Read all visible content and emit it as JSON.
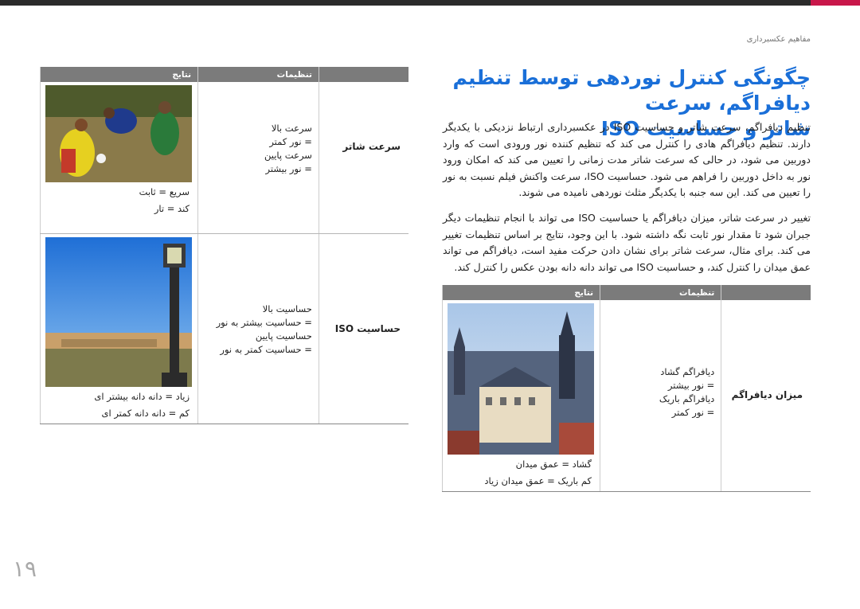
{
  "header": {
    "section": "مفاهیم عکسبرداری"
  },
  "title": {
    "line1": "چگونگی کنترل نوردهی توسط تنظیم دیافراگم، سرعت",
    "line2": "شاتر و حساسیت ISO"
  },
  "paragraphs": [
    "تنظیم دیافراگم، سرعت شاتر و حساسیت ISO در عکسبرداری ارتباط نزدیکی با یکدیگر دارند. تنظیم دیافراگم هادی را کنترل می کند که تنظیم کننده نور ورودی است که وارد دوربین می شود، در حالی که سرعت شاتر مدت زمانی را تعیین می کند که امکان ورود نور به داخل دوربین را فراهم می شود. حساسیت ISO، سرعت واکنش فیلم نسبت به نور را تعیین می کند. این سه جنبه با یکدیگر مثلث نوردهی نامیده می شوند.",
    "تغییر در سرعت شاتر، میزان دیافراگم یا حساسیت ISO می تواند با انجام تنظیمات دیگر جبران شود تا مقدار نور ثابت نگه داشته شود. با این وجود، نتایج بر اساس تنظیمات تغییر می کند. برای مثال، سرعت شاتر برای نشان دادن حرکت مفید است، دیافراگم می تواند عمق میدان را کنترل کند، و حساسیت ISO می تواند دانه دانه بودن عکس را کنترل کند."
  ],
  "table1": {
    "headers": [
      "تنظیمات",
      "نتایج"
    ],
    "rows": [
      {
        "name": "سرعت شاتر",
        "options": [
          "سرعت بالا",
          "= نور کمتر",
          "سرعت پایین",
          "= نور بیشتر"
        ],
        "captions": [
          "سریع = ثابت",
          "کند = تار"
        ]
      },
      {
        "name": "حساسیت ISO",
        "options": [
          "حساسیت بالا",
          "= حساسیت بیشتر به نور",
          "حساسیت پایین",
          "= حساسیت کمتر به نور"
        ],
        "captions": [
          "زیاد = دانه دانه بیشتر ای",
          "کم = دانه دانه کمتر ای"
        ]
      }
    ]
  },
  "table2": {
    "headers": [
      "تنظیمات",
      "نتایج"
    ],
    "rows": [
      {
        "name": "میزان دیافراگم",
        "options": [
          "دیافراگم گشاد",
          "= نور بیشتر",
          "دیافراگم باریک",
          "= نور کمتر"
        ],
        "captions": [
          "گشاد = عمق میدان",
          "کم باریک = عمق میدان زیاد"
        ]
      }
    ]
  },
  "page_number": "۱۹",
  "colors": {
    "title": "#1a6fd8",
    "header_bar": "#7b7b7b",
    "accent": "#c8174a"
  }
}
